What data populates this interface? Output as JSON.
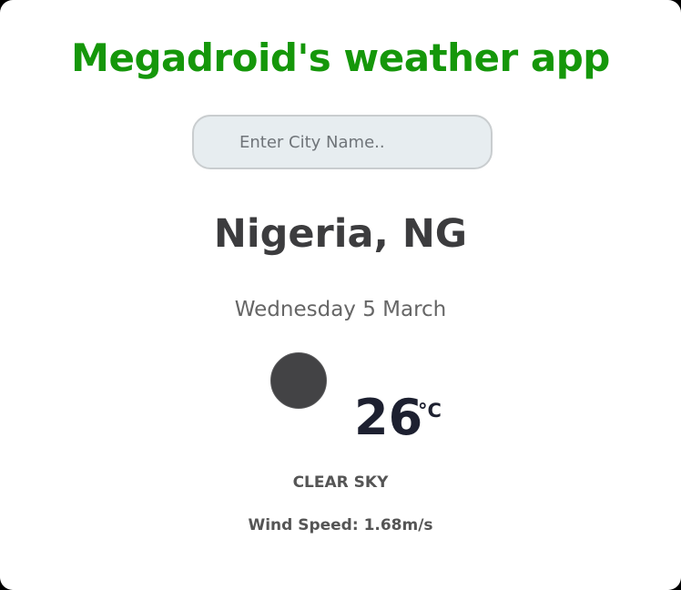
{
  "app": {
    "title": "Megadroid's weather app"
  },
  "search": {
    "placeholder": "Enter City Name..",
    "value": ""
  },
  "weather": {
    "location": "Nigeria, NG",
    "date": "Wednesday 5 March",
    "icon": "weather-condition-icon",
    "temperature": "26",
    "unit": "°C",
    "description": "CLEAR SKY",
    "wind_speed": "Wind Speed: 1.68m/s"
  },
  "colors": {
    "title": "#15970a",
    "input_background": "#e7edf0",
    "icon": "#434345",
    "temperature": "#1d2030"
  }
}
